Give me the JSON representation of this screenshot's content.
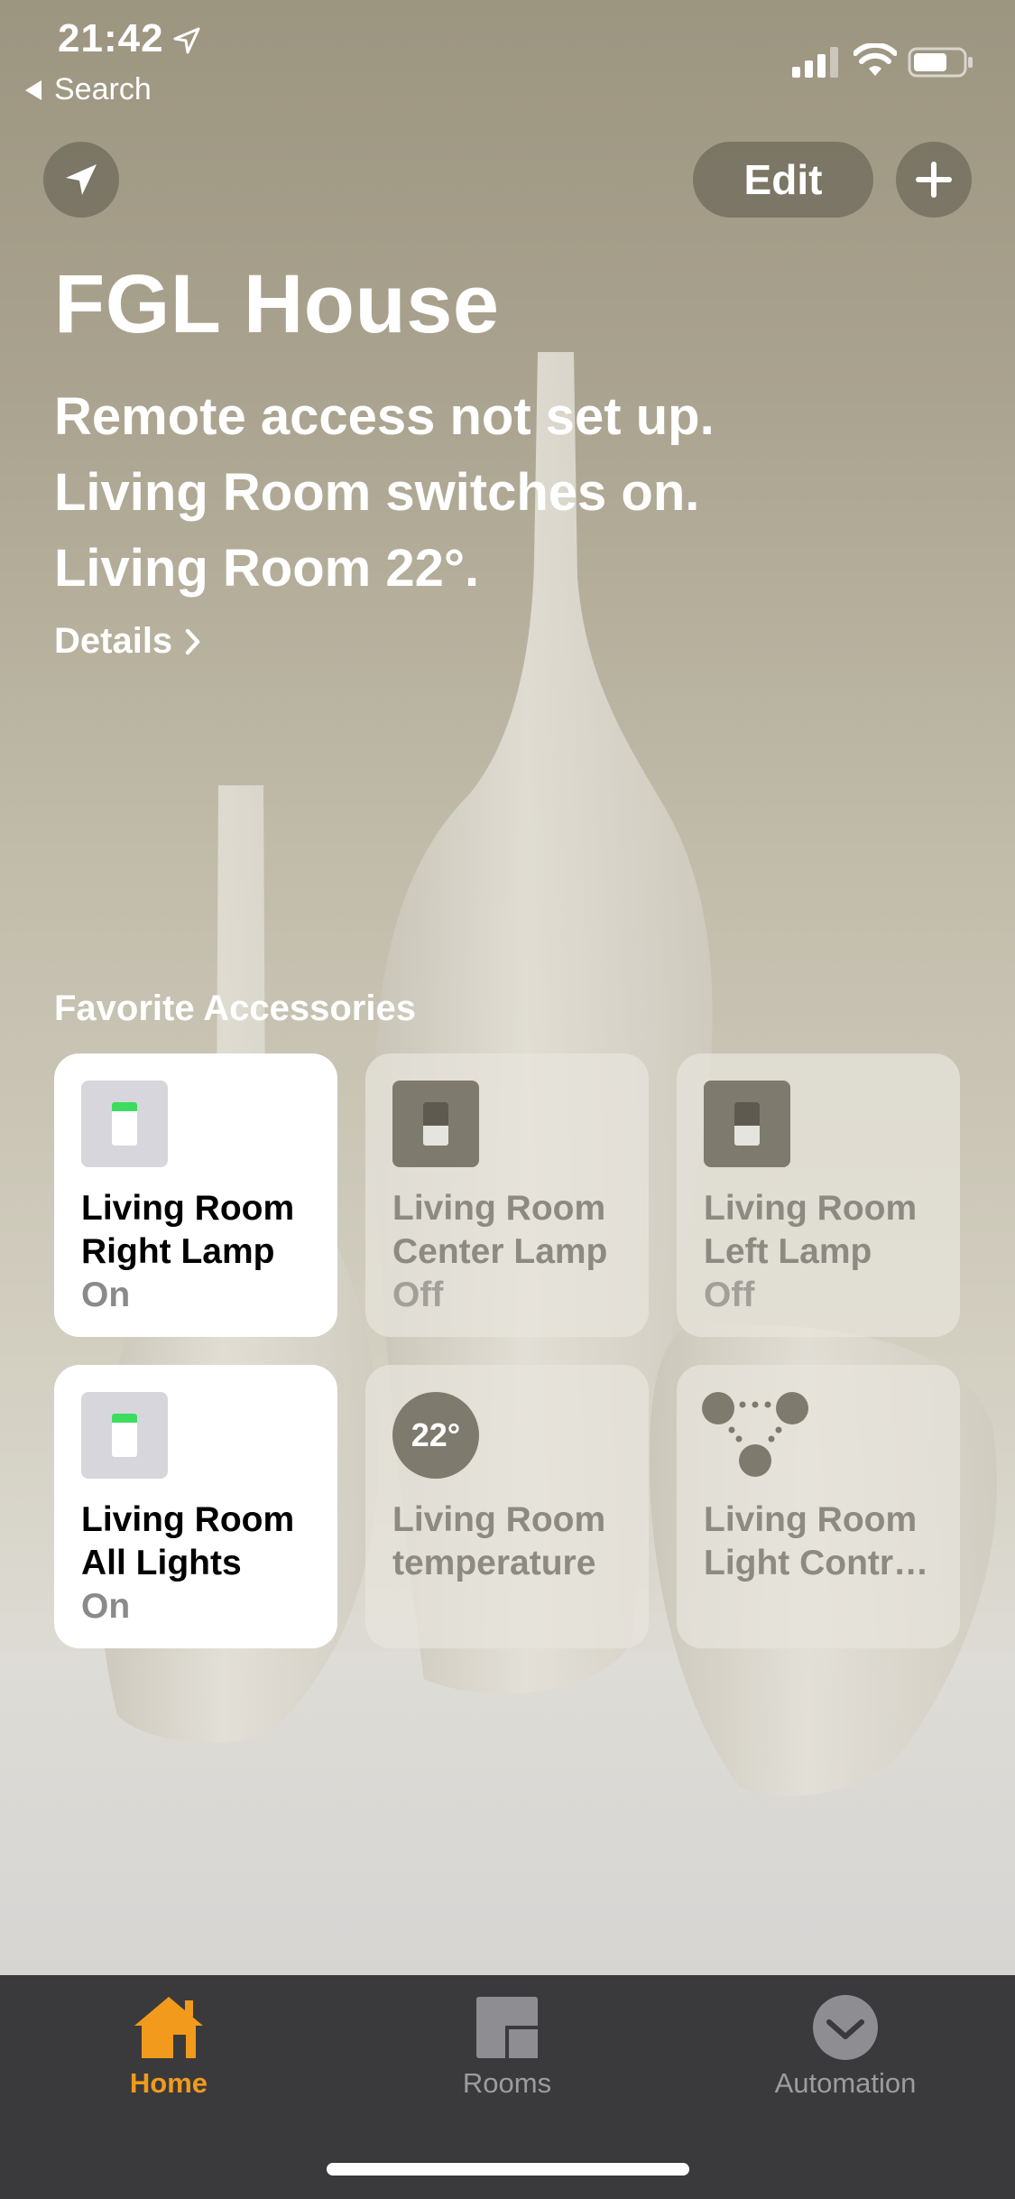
{
  "status_bar": {
    "time": "21:42",
    "back_label": "Search"
  },
  "top_controls": {
    "edit_label": "Edit"
  },
  "header": {
    "title": "FGL House",
    "status_lines": [
      "Remote access not set up.",
      "Living Room switches on.",
      "Living Room 22°."
    ],
    "details_label": "Details"
  },
  "favorites": {
    "title": "Favorite Accessories",
    "tiles": [
      {
        "name_line1": "Living Room",
        "name_line2": "Right Lamp",
        "state": "On",
        "icon": "light-switch-icon",
        "on": true
      },
      {
        "name_line1": "Living Room",
        "name_line2": "Center Lamp",
        "state": "Off",
        "icon": "light-switch-icon",
        "on": false
      },
      {
        "name_line1": "Living Room",
        "name_line2": "Left Lamp",
        "state": "Off",
        "icon": "light-switch-icon",
        "on": false
      },
      {
        "name_line1": "Living Room",
        "name_line2": "All Lights",
        "state": "On",
        "icon": "light-switch-icon",
        "on": true
      },
      {
        "name_line1": "Living Room",
        "name_line2": "temperature",
        "state": "",
        "icon": "thermometer-icon",
        "value": "22°",
        "on": false
      },
      {
        "name_line1": "Living Room",
        "name_line2": "Light Contr…",
        "state": "",
        "icon": "bridge-icon",
        "on": false
      }
    ]
  },
  "tabbar": {
    "tabs": [
      {
        "label": "Home",
        "icon": "house-icon",
        "active": true
      },
      {
        "label": "Rooms",
        "icon": "rooms-icon",
        "active": false
      },
      {
        "label": "Automation",
        "icon": "clock-check-icon",
        "active": false
      }
    ]
  },
  "colors": {
    "accent": "#f19a1c",
    "switch_led": "#3ddc5f",
    "tabbar_bg": "#3a3a3c"
  }
}
